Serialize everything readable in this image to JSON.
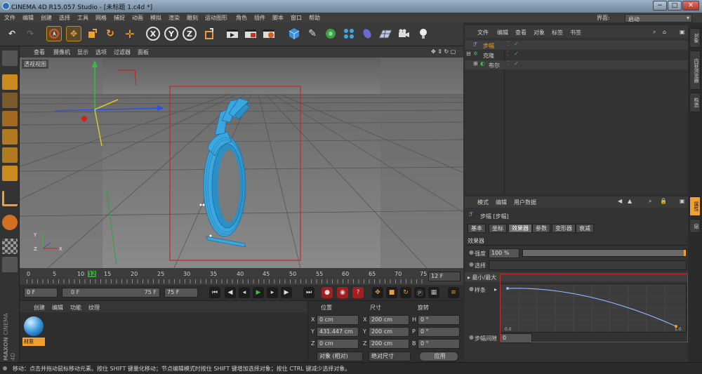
{
  "window": {
    "title": "CINEMA 4D R15.057 Studio - [未标题 1.c4d *]",
    "controls": [
      "−",
      "□",
      "✕"
    ]
  },
  "menubar": {
    "items": [
      "文件",
      "编辑",
      "创建",
      "选择",
      "工具",
      "网格",
      "捕捉",
      "动画",
      "模拟",
      "渲染",
      "雕刻",
      "运动图形",
      "角色",
      "插件",
      "脚本",
      "窗口",
      "帮助"
    ],
    "layout_label": "界面:",
    "layout_value": "启动"
  },
  "toolbar": {
    "axis_buttons": [
      "X",
      "Y",
      "Z"
    ],
    "icons": [
      "undo-icon",
      "redo-icon",
      "live-select-icon",
      "move-icon",
      "scale-icon",
      "rotate-icon",
      "add-object-icon",
      "x-axis-icon",
      "y-axis-icon",
      "z-axis-icon",
      "coordinate-system-icon",
      "render-view-icon",
      "render-picture-viewer-icon",
      "render-settings-icon",
      "cube-icon",
      "spline-pen-icon",
      "subdivision-icon",
      "array-icon",
      "deformer-icon",
      "floor-icon",
      "camera-icon",
      "light-icon"
    ]
  },
  "viewport": {
    "menu": [
      "查看",
      "摄像机",
      "显示",
      "选项",
      "过滤器",
      "面板"
    ],
    "label": "透视视图",
    "axes_labels": [
      "Y",
      "X",
      "Z"
    ]
  },
  "timeline": {
    "ticks": [
      "0",
      "5",
      "10",
      "12",
      "15",
      "20",
      "25",
      "30",
      "35",
      "40",
      "45",
      "50",
      "55",
      "60",
      "65",
      "70",
      "75"
    ],
    "current_frame_marker": "12",
    "end_field": "12 F"
  },
  "transport": {
    "start_frame": "0 F",
    "range_start": "0 F",
    "range_end": "75 F",
    "end_frame": "75 F"
  },
  "materials": {
    "menu": [
      "创建",
      "编辑",
      "功能",
      "纹理"
    ],
    "items": [
      {
        "label": "材质"
      }
    ]
  },
  "brand": {
    "maxon": "MAXON",
    "cinema": "CINEMA 4D"
  },
  "coordinates": {
    "headers": [
      "位置",
      "尺寸",
      "旋转"
    ],
    "rows": [
      {
        "axis": "X",
        "pos": "0 cm",
        "size_axis": "X",
        "size": "200 cm",
        "rot_axis": "H",
        "rot": "0 °"
      },
      {
        "axis": "Y",
        "pos": "431.447 cm",
        "size_axis": "Y",
        "size": "200 cm",
        "rot_axis": "P",
        "rot": "0 °"
      },
      {
        "axis": "Z",
        "pos": "0 cm",
        "size_axis": "Z",
        "size": "200 cm",
        "rot_axis": "B",
        "rot": "0 °"
      }
    ],
    "mode_select": "对象 (相对)",
    "size_select": "绝对尺寸",
    "apply_button": "应用"
  },
  "object_manager": {
    "menu": [
      "文件",
      "编辑",
      "查看",
      "对象",
      "标签",
      "书签"
    ],
    "objects": [
      {
        "name": "步幅",
        "indent": 0,
        "color": "#f0a030"
      },
      {
        "name": "克隆",
        "indent": 0,
        "color": "#d8d8d8"
      },
      {
        "name": "布尔",
        "indent": 1,
        "color": "#d8d8d8"
      }
    ]
  },
  "attribute_manager": {
    "menu": [
      "模式",
      "编辑",
      "用户数据"
    ],
    "object_title": "步幅 [步幅]",
    "tabs": [
      "基本",
      "坐标",
      "效果器",
      "参数",
      "变形器",
      "衰减"
    ],
    "active_tab": "效果器",
    "section": "效果器",
    "strength_label": "强度",
    "strength_value": "100 %",
    "strength_fraction": 1.0,
    "selection_label": "选择",
    "minmax_label": "▸ 最小/最大",
    "spline_label": "样条",
    "graph_ticks": [
      "0.0",
      "1.0",
      "0.0",
      "1.0"
    ],
    "step_gap_label": "步幅间隙",
    "step_gap_value": "0"
  },
  "right_tabs": [
    "对象",
    "内容浏览器",
    "构造",
    "属性",
    "层"
  ],
  "status": {
    "text": "移动：点击并拖动鼠标移动元素。按住 SHIFT 键量化移动；节点编辑模式时按住 SHIFT 键增加选择对象；按住 CTRL 键减少选择对象。"
  },
  "colors": {
    "accent": "#f0a030",
    "object_cyan": "#3aa7e0",
    "selection_red": "#c62828"
  }
}
